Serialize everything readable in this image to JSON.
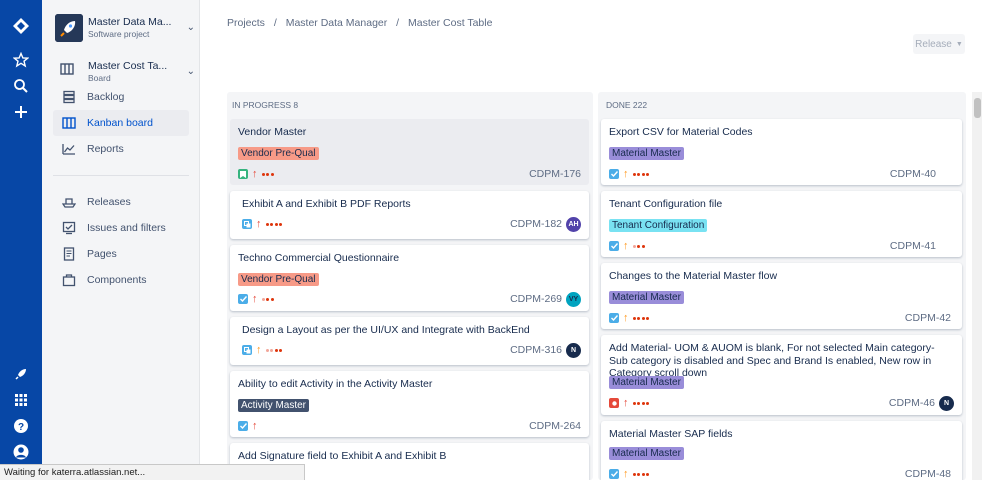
{
  "project": {
    "name": "Master Data Ma...",
    "type": "Software project"
  },
  "board_switch": {
    "name": "Master Cost Ta...",
    "type": "Board"
  },
  "nav": {
    "backlog": "Backlog",
    "kanban": "Kanban board",
    "reports": "Reports",
    "releases": "Releases",
    "issues": "Issues and filters",
    "pages": "Pages",
    "components": "Components"
  },
  "breadcrumbs": {
    "projects": "Projects",
    "sep": "/",
    "project": "Master Data Manager",
    "board": "Master Cost Table"
  },
  "release_button": "Release",
  "columns": {
    "in_progress": {
      "header": "IN PROGRESS 8",
      "cards": [
        {
          "title": "Vendor Master",
          "epic": "Vendor Pre-Qual",
          "key": "CDPM-176"
        },
        {
          "title": "Exhibit A and Exhibit B PDF Reports",
          "key": "CDPM-182",
          "avatar": "AH"
        },
        {
          "title": "Techno Commercial Questionnaire",
          "epic": "Vendor Pre-Qual",
          "key": "CDPM-269",
          "avatar": "VY"
        },
        {
          "title": "Design a Layout as per the UI/UX and Integrate with BackEnd",
          "key": "CDPM-316",
          "avatar": "N"
        },
        {
          "title": "Ability to edit Activity in the Activity Master",
          "epic": "Activity Master",
          "key": "CDPM-264"
        },
        {
          "title": "Add Signature field to Exhibit A and Exhibit B"
        }
      ]
    },
    "done": {
      "header": "DONE 222",
      "cards": [
        {
          "title": "Export CSV for Material Codes",
          "epic": "Material Master",
          "key": "CDPM-40"
        },
        {
          "title": "Tenant Configuration file",
          "epic": "Tenant Configuration",
          "key": "CDPM-41"
        },
        {
          "title": "Changes to the Material Master flow",
          "epic": "Material Master",
          "key": "CDPM-42"
        },
        {
          "title": "Add Material- UOM & AUOM is blank, For not selected Main category- Sub category is disabled and Spec and Brand Is enabled, New row in Category scroll down",
          "epic": "Material Master",
          "key": "CDPM-46",
          "avatar": "N"
        },
        {
          "title": "Material Master SAP fields",
          "epic": "Material Master",
          "key": "CDPM-48"
        }
      ]
    }
  },
  "status_bar": "Waiting for katerra.atlassian.net...",
  "colors": {
    "nav_bg": "#0747a6",
    "vendor_epic": "#f79a87",
    "material_epic": "#998dd9",
    "tenant_epic": "#79e2f2",
    "activity_epic": "#42526e",
    "story_green": "#36b37e",
    "task_blue": "#4bade8",
    "bug_red": "#e5493a"
  }
}
